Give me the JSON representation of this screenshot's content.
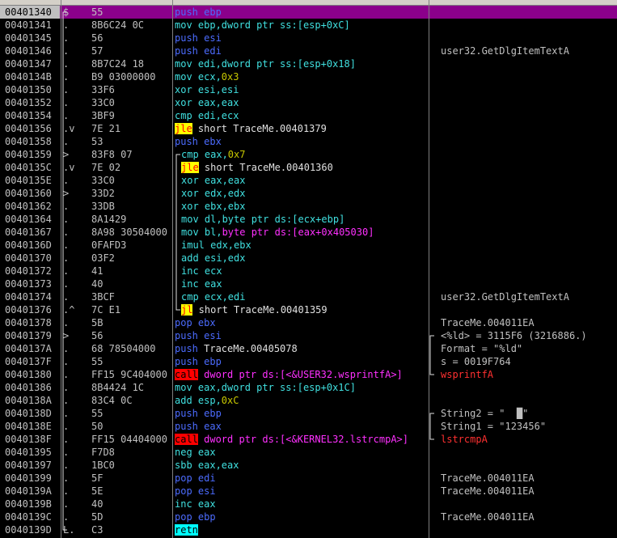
{
  "rows": [
    {
      "addr": "00401340",
      "fm": "$",
      "hex": "55",
      "cmt": "",
      "asm": [
        {
          "t": "push",
          "c": "blue"
        },
        {
          "t": " ebp",
          "c": "blue"
        }
      ],
      "sel": true
    },
    {
      "addr": "00401341",
      "fm": ".",
      "hex": "8B6C24 0C",
      "cmt": "",
      "asm": [
        {
          "t": "mov ebp,dword ptr ss:[esp+0xC]",
          "c": "cyan"
        }
      ]
    },
    {
      "addr": "00401345",
      "fm": ".",
      "hex": "56",
      "cmt": "",
      "asm": [
        {
          "t": "push esi",
          "c": "blue"
        }
      ]
    },
    {
      "addr": "00401346",
      "fm": ".",
      "hex": "57",
      "cmt": "user32.GetDlgItemTextA",
      "asm": [
        {
          "t": "push edi",
          "c": "blue"
        }
      ]
    },
    {
      "addr": "00401347",
      "fm": ".",
      "hex": "8B7C24 18",
      "cmt": "",
      "asm": [
        {
          "t": "mov edi,dword ptr ss:[esp+0x18]",
          "c": "cyan"
        }
      ]
    },
    {
      "addr": "0040134B",
      "fm": ".",
      "hex": "B9 03000000",
      "cmt": "",
      "asm": [
        {
          "t": "mov ecx,",
          "c": "cyan"
        },
        {
          "t": "0x3",
          "c": "yellow"
        }
      ]
    },
    {
      "addr": "00401350",
      "fm": ".",
      "hex": "33F6",
      "cmt": "",
      "asm": [
        {
          "t": "xor esi,esi",
          "c": "cyan"
        }
      ]
    },
    {
      "addr": "00401352",
      "fm": ".",
      "hex": "33C0",
      "cmt": "",
      "asm": [
        {
          "t": "xor eax,eax",
          "c": "cyan"
        }
      ]
    },
    {
      "addr": "00401354",
      "fm": ".",
      "hex": "3BF9",
      "cmt": "",
      "asm": [
        {
          "t": "cmp edi,ecx",
          "c": "cyan"
        }
      ]
    },
    {
      "addr": "00401356",
      "fm": ".v",
      "hex": "7E 21",
      "cmt": "",
      "asm": [
        {
          "t": "jle",
          "c": "hl-yel"
        },
        {
          "t": " short TraceMe.00401379",
          "c": "white"
        }
      ]
    },
    {
      "addr": "00401358",
      "fm": ".",
      "hex": "53",
      "cmt": "",
      "asm": [
        {
          "t": "push ebx",
          "c": "blue"
        }
      ]
    },
    {
      "addr": "00401359",
      "fm": ">",
      "hex": "83F8 07",
      "cmt": "",
      "ind": true,
      "asm": [
        {
          "t": "cmp eax,",
          "c": "cyan"
        },
        {
          "t": "0x7",
          "c": "yellow"
        }
      ]
    },
    {
      "addr": "0040135C",
      "fm": ".v",
      "hex": "7E 02",
      "cmt": "",
      "ind": true,
      "asm": [
        {
          "t": "jle",
          "c": "hl-yel"
        },
        {
          "t": " short TraceMe.00401360",
          "c": "white"
        }
      ]
    },
    {
      "addr": "0040135E",
      "fm": ".",
      "hex": "33C0",
      "cmt": "",
      "ind": true,
      "asm": [
        {
          "t": "xor eax,eax",
          "c": "cyan"
        }
      ]
    },
    {
      "addr": "00401360",
      "fm": ">",
      "hex": "33D2",
      "cmt": "",
      "ind": true,
      "asm": [
        {
          "t": "xor edx,edx",
          "c": "cyan"
        }
      ]
    },
    {
      "addr": "00401362",
      "fm": ".",
      "hex": "33DB",
      "cmt": "",
      "ind": true,
      "asm": [
        {
          "t": "xor ebx,ebx",
          "c": "cyan"
        }
      ]
    },
    {
      "addr": "00401364",
      "fm": ".",
      "hex": "8A1429",
      "cmt": "",
      "ind": true,
      "asm": [
        {
          "t": "mov dl,byte ptr ds:[ecx+ebp]",
          "c": "cyan"
        }
      ]
    },
    {
      "addr": "00401367",
      "fm": ".",
      "hex": "8A98 30504000",
      "cmt": "",
      "ind": true,
      "asm": [
        {
          "t": "mov bl,",
          "c": "cyan"
        },
        {
          "t": "byte ptr ds:[eax+0x405030]",
          "c": "mag"
        }
      ]
    },
    {
      "addr": "0040136D",
      "fm": ".",
      "hex": "0FAFD3",
      "cmt": "",
      "ind": true,
      "asm": [
        {
          "t": "imul edx,ebx",
          "c": "cyan"
        }
      ]
    },
    {
      "addr": "00401370",
      "fm": ".",
      "hex": "03F2",
      "cmt": "",
      "ind": true,
      "asm": [
        {
          "t": "add esi,edx",
          "c": "cyan"
        }
      ]
    },
    {
      "addr": "00401372",
      "fm": ".",
      "hex": "41",
      "cmt": "",
      "ind": true,
      "asm": [
        {
          "t": "inc ecx",
          "c": "cyan"
        }
      ]
    },
    {
      "addr": "00401373",
      "fm": ".",
      "hex": "40",
      "cmt": "",
      "ind": true,
      "asm": [
        {
          "t": "inc eax",
          "c": "cyan"
        }
      ]
    },
    {
      "addr": "00401374",
      "fm": ".",
      "hex": "3BCF",
      "cmt": "user32.GetDlgItemTextA",
      "ind": true,
      "asm": [
        {
          "t": "cmp ecx,edi",
          "c": "cyan"
        }
      ]
    },
    {
      "addr": "00401376",
      "fm": ".^",
      "hex": "7C E1",
      "cmt": "",
      "ind": true,
      "asm": [
        {
          "t": "jl",
          "c": "hl-yel"
        },
        {
          "t": " short TraceMe.00401359",
          "c": "white"
        }
      ]
    },
    {
      "addr": "00401378",
      "fm": ".",
      "hex": "5B",
      "cmt": "TraceMe.004011EA",
      "asm": [
        {
          "t": "pop ebx",
          "c": "blue"
        }
      ]
    },
    {
      "addr": "00401379",
      "fm": ">",
      "hex": "56",
      "cmt": "<%ld> = 3115F6 (3216886.)",
      "asm": [
        {
          "t": "push esi",
          "c": "blue"
        }
      ]
    },
    {
      "addr": "0040137A",
      "fm": ".",
      "hex": "68 78504000",
      "cmt": "Format = \"%ld\"",
      "asm": [
        {
          "t": "push",
          "c": "blue"
        },
        {
          "t": " TraceMe.00405078",
          "c": "white"
        }
      ]
    },
    {
      "addr": "0040137F",
      "fm": ".",
      "hex": "55",
      "cmt": "s = 0019F764",
      "asm": [
        {
          "t": "push ebp",
          "c": "blue"
        }
      ]
    },
    {
      "addr": "00401380",
      "fm": ".",
      "hex": "FF15 9C404000",
      "cmt": "wsprintfA",
      "cmtc": "red",
      "asm": [
        {
          "t": "call",
          "c": "hl-red"
        },
        {
          "t": " dword ptr ds:[<&USER32.wsprintfA>]",
          "c": "mag"
        }
      ]
    },
    {
      "addr": "00401386",
      "fm": ".",
      "hex": "8B4424 1C",
      "cmt": "",
      "asm": [
        {
          "t": "mov eax,dword ptr ss:[esp+0x1C]",
          "c": "cyan"
        }
      ]
    },
    {
      "addr": "0040138A",
      "fm": ".",
      "hex": "83C4 0C",
      "cmt": "",
      "asm": [
        {
          "t": "add esp,",
          "c": "cyan"
        },
        {
          "t": "0xC",
          "c": "yellow"
        }
      ]
    },
    {
      "addr": "0040138D",
      "fm": ".",
      "hex": "55",
      "cmt": "String2 = \"  █\"",
      "asm": [
        {
          "t": "push ebp",
          "c": "blue"
        }
      ]
    },
    {
      "addr": "0040138E",
      "fm": ".",
      "hex": "50",
      "cmt": "String1 = \"123456\"",
      "asm": [
        {
          "t": "push eax",
          "c": "blue"
        }
      ]
    },
    {
      "addr": "0040138F",
      "fm": ".",
      "hex": "FF15 04404000",
      "cmt": "lstrcmpA",
      "cmtc": "red",
      "asm": [
        {
          "t": "call",
          "c": "hl-red"
        },
        {
          "t": " dword ptr ds:[<&KERNEL32.lstrcmpA>]",
          "c": "mag"
        }
      ]
    },
    {
      "addr": "00401395",
      "fm": ".",
      "hex": "F7D8",
      "cmt": "",
      "asm": [
        {
          "t": "neg eax",
          "c": "cyan"
        }
      ]
    },
    {
      "addr": "00401397",
      "fm": ".",
      "hex": "1BC0",
      "cmt": "",
      "asm": [
        {
          "t": "sbb eax,eax",
          "c": "cyan"
        }
      ]
    },
    {
      "addr": "00401399",
      "fm": ".",
      "hex": "5F",
      "cmt": "TraceMe.004011EA",
      "asm": [
        {
          "t": "pop edi",
          "c": "blue"
        }
      ]
    },
    {
      "addr": "0040139A",
      "fm": ".",
      "hex": "5E",
      "cmt": "TraceMe.004011EA",
      "asm": [
        {
          "t": "pop esi",
          "c": "blue"
        }
      ]
    },
    {
      "addr": "0040139B",
      "fm": ".",
      "hex": "40",
      "cmt": "",
      "asm": [
        {
          "t": "inc eax",
          "c": "cyan"
        }
      ]
    },
    {
      "addr": "0040139C",
      "fm": ".",
      "hex": "5D",
      "cmt": "TraceMe.004011EA",
      "asm": [
        {
          "t": "pop ebp",
          "c": "blue"
        }
      ]
    },
    {
      "addr": "0040139D",
      "fm": "L.",
      "hex": "C3",
      "cmt": "",
      "asm": [
        {
          "t": "retn",
          "c": "hl-cyan"
        }
      ]
    }
  ]
}
